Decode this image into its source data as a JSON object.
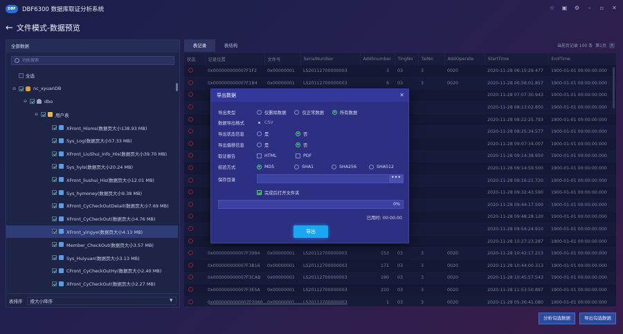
{
  "window": {
    "logo_text": "DBF",
    "title": "DBF6300 数据库取证分析系统",
    "controls": [
      "☆",
      "▣",
      "⚙",
      "–",
      "▫",
      "✕"
    ]
  },
  "page": {
    "title": "文件模式-数据预览"
  },
  "left_panel": {
    "header": "全部数据",
    "search_placeholder": "功能搜索",
    "tree": [
      {
        "label": "全选",
        "depth": 0,
        "caret": "",
        "check": false,
        "icon": "",
        "selected": false
      },
      {
        "label": "nc_xyuanDB",
        "depth": 0,
        "caret": "⊖",
        "check": true,
        "icon": "db",
        "selected": false
      },
      {
        "label": "dbo",
        "depth": 1,
        "caret": "⊖",
        "check": true,
        "icon": "user",
        "selected": false
      },
      {
        "label": "用户表",
        "depth": 2,
        "caret": "⊖",
        "check": true,
        "icon": "folder",
        "selected": false
      },
      {
        "label": "XFront_Hisms(数据页大小138.93 MB)",
        "depth": 3,
        "caret": "",
        "check": true,
        "icon": "table",
        "selected": false
      },
      {
        "label": "Sys_Log(数据页大小57.33 MB)",
        "depth": 3,
        "caret": "",
        "check": true,
        "icon": "table",
        "selected": false
      },
      {
        "label": "XFront_LiuShui_Info_His(数据页大小39.70 MB)",
        "depth": 3,
        "caret": "",
        "check": true,
        "icon": "table",
        "selected": false
      },
      {
        "label": "Sys_hyls(数据页大小20.24 MB)",
        "depth": 3,
        "caret": "",
        "check": true,
        "icon": "table",
        "selected": false
      },
      {
        "label": "XFront_liushui_His(数据页大小12.01 MB)",
        "depth": 3,
        "caret": "",
        "check": true,
        "icon": "table",
        "selected": false
      },
      {
        "label": "Sys_hymoney(数据页大小9.38 MB)",
        "depth": 3,
        "caret": "",
        "check": true,
        "icon": "table",
        "selected": false
      },
      {
        "label": "XFront_CyCheckOutDetail(数据页大小7.69 MB)",
        "depth": 3,
        "caret": "",
        "check": true,
        "icon": "table",
        "selected": false
      },
      {
        "label": "XFront_CyCheckOut(数据页大小4.76 MB)",
        "depth": 3,
        "caret": "",
        "check": true,
        "icon": "table",
        "selected": false
      },
      {
        "label": "XFront_yingye(数据页大小4.13 MB)",
        "depth": 3,
        "caret": "",
        "check": true,
        "icon": "table",
        "selected": true
      },
      {
        "label": "Member_CheckOut(数据页大小3.57 MB)",
        "depth": 3,
        "caret": "",
        "check": true,
        "icon": "table",
        "selected": false
      },
      {
        "label": "Sys_Huiyuan(数据页大小3.13 MB)",
        "depth": 3,
        "caret": "",
        "check": true,
        "icon": "table",
        "selected": false
      },
      {
        "label": "CFront_CyCheckOutHy(数据页大小2.40 MB)",
        "depth": 3,
        "caret": "",
        "check": true,
        "icon": "table",
        "selected": false
      },
      {
        "label": "XFront_CyCheckOut(数据页大小2.27 MB)",
        "depth": 3,
        "caret": "",
        "check": true,
        "icon": "table",
        "selected": false
      }
    ],
    "sort_label": "表排序",
    "sort_value": "按大小降序"
  },
  "tabs": [
    {
      "label": "表记录",
      "active": true
    },
    {
      "label": "表结构",
      "active": false
    }
  ],
  "pager": {
    "text": "当前页记录 100 条",
    "page": "第1页",
    "next": "›"
  },
  "grid": {
    "columns": [
      "状态",
      "记录位置",
      "文件号",
      "SerialNumber",
      "AddSnumber",
      "TingNo",
      "TaiNo",
      "AddOperate",
      "StartTime",
      "EndTime"
    ],
    "rows": [
      [
        "0x000000000007F1F2",
        "0x00000001",
        "LS20112700000003",
        "3",
        "03",
        "3",
        "0020",
        "2020-11-28 06:15:29.477",
        "1900-01-01 00:00:00.000"
      ],
      [
        "0x000000000007F1B4",
        "0x00000001",
        "LS20112700000003",
        "6",
        "03",
        "3",
        "0020",
        "2020-11-28 06:58:01.857",
        "1900-01-01 00:00:00.000"
      ],
      [
        "",
        "",
        "",
        "",
        "",
        "",
        "",
        "2020-11-28 07:07:30.943",
        "1900-01-01 00:00:00.000"
      ],
      [
        "",
        "",
        "",
        "",
        "",
        "",
        "",
        "2020-11-28 08:13:02.850",
        "1900-01-01 00:00:00.000"
      ],
      [
        "",
        "",
        "",
        "",
        "",
        "",
        "",
        "2020-11-28 08:22:25.793",
        "1900-01-01 00:00:00.000"
      ],
      [
        "",
        "",
        "",
        "",
        "",
        "",
        "",
        "2020-11-28 08:25:34.577",
        "1900-01-01 00:00:00.000"
      ],
      [
        "",
        "",
        "",
        "",
        "",
        "",
        "",
        "2020-11-28 09:07:34.007",
        "1900-01-01 00:00:00.000"
      ],
      [
        "",
        "",
        "",
        "",
        "",
        "",
        "",
        "2020-11-28 09:14:38.950",
        "1900-01-01 00:00:00.000"
      ],
      [
        "",
        "",
        "",
        "",
        "",
        "",
        "",
        "2020-11-28 09:14:59.500",
        "1900-01-01 00:00:00.000"
      ],
      [
        "",
        "",
        "",
        "",
        "",
        "",
        "",
        "2020-11-28 09:16:21.720",
        "1900-01-01 00:00:00.000"
      ],
      [
        "",
        "",
        "",
        "",
        "",
        "",
        "",
        "2020-11-28 09:32:43.590",
        "1900-01-01 00:00:00.000"
      ],
      [
        "",
        "",
        "",
        "",
        "",
        "",
        "",
        "2020-11-28 09:44:17.500",
        "1900-01-01 00:00:00.000"
      ],
      [
        "",
        "",
        "",
        "",
        "",
        "",
        "",
        "2020-11-28 09:48:28.120",
        "1900-01-01 00:00:00.000"
      ],
      [
        "",
        "",
        "",
        "",
        "",
        "",
        "",
        "2020-11-28 09:54:24.910",
        "1900-01-01 00:00:00.000"
      ],
      [
        "",
        "",
        "",
        "",
        "",
        "",
        "",
        "2020-11-28 10:27:23.287",
        "1900-01-01 00:00:00.000"
      ],
      [
        "0x000000000007F3984",
        "0x00000001",
        "LS20112700000003",
        "153",
        "03",
        "3",
        "0020",
        "2020-11-28 10:42:17.213",
        "1900-01-01 00:00:00.000"
      ],
      [
        "0x000000000007F3B16",
        "0x00000001",
        "LS20112700000003",
        "171",
        "03",
        "3",
        "0020",
        "2020-11-28 10:44:00.313",
        "1900-01-01 00:00:00.000"
      ],
      [
        "0x000000000007F3CAB",
        "0x00000001",
        "LS20112700000003",
        "190",
        "03",
        "3",
        "0020",
        "2020-11-28 10:45:57.543",
        "1900-01-01 00:00:00.000"
      ],
      [
        "0x000000000007F3E5A",
        "0x00000001",
        "LS20112700000003",
        "210",
        "03",
        "3",
        "0020",
        "2020-11-28 11:53:50.897",
        "1900-01-01 00:00:00.000"
      ],
      [
        "0x0000000000007F2060",
        "0x00000001",
        "LS20112700000003",
        "1",
        "03",
        "3",
        "0020",
        "2020-11-28 05:36:41.080",
        "1900-01-01 00:00:00.000"
      ]
    ]
  },
  "dialog": {
    "title": "导出数据",
    "close": "✕",
    "export_type": {
      "label": "导出类型",
      "options": [
        "仅删除数据",
        "仅正常数据",
        "所有数据"
      ],
      "selected": 2
    },
    "export_format": {
      "label": "数据导出格式",
      "value": "CSV"
    },
    "export_status": {
      "label": "导出状态信息",
      "options": [
        "是",
        "否"
      ],
      "selected": 1
    },
    "export_offset": {
      "label": "导出偏移信息",
      "options": [
        "是",
        "否"
      ],
      "selected": 1
    },
    "report": {
      "label": "取证报告",
      "options": [
        "HTML",
        "PDF"
      ]
    },
    "checksum": {
      "label": "校验方式",
      "options": [
        "MD5",
        "SHA1",
        "SHA256",
        "SHA512"
      ],
      "selected": 0
    },
    "save_dir": {
      "label": "保存目录",
      "value": "",
      "browse": "•••"
    },
    "open_folder": {
      "label": "完成后打开文件夹",
      "checked": true
    },
    "progress": {
      "percent": 0,
      "text": "0%"
    },
    "elapsed": "已用时: 00:00:00",
    "export_button": "导出"
  },
  "bottom_buttons": [
    "分析勾选数据",
    "导出勾选数据"
  ],
  "colors": {
    "accent": "#1aa6f2",
    "status_red": "#e23d55",
    "hex_text": "#d7a33d",
    "check_green": "#4fd07f"
  }
}
